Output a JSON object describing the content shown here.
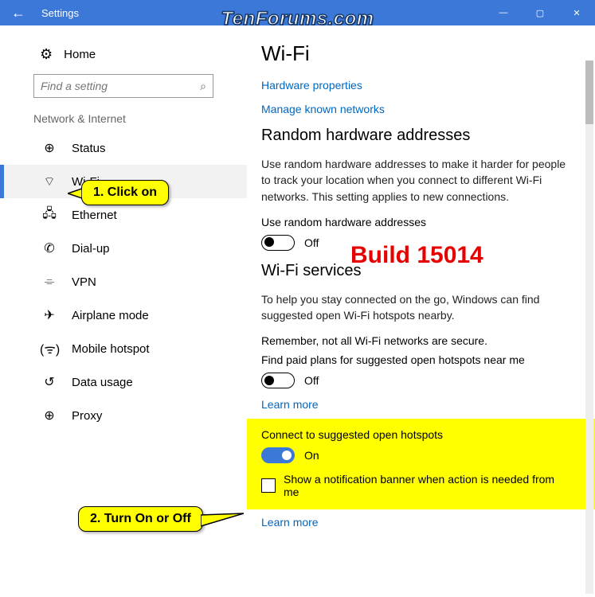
{
  "titlebar": {
    "title": "Settings",
    "back_icon": "←",
    "min_icon": "—",
    "max_icon": "▢",
    "close_icon": "✕"
  },
  "watermark": "TenForums.com",
  "sidebar": {
    "home_label": "Home",
    "gear_icon": "⚙",
    "search_placeholder": "Find a setting",
    "search_icon": "⌕",
    "section_label": "Network & Internet",
    "items": [
      {
        "icon": "⊕",
        "label": "Status"
      },
      {
        "icon": "⌔",
        "label": "Wi-Fi"
      },
      {
        "icon": "🖧",
        "label": "Ethernet"
      },
      {
        "icon": "✆",
        "label": "Dial-up"
      },
      {
        "icon": "⌯",
        "label": "VPN"
      },
      {
        "icon": "✈",
        "label": "Airplane mode"
      },
      {
        "icon": "(ᯤ)",
        "label": "Mobile hotspot"
      },
      {
        "icon": "↺",
        "label": "Data usage"
      },
      {
        "icon": "⊕",
        "label": "Proxy"
      }
    ],
    "selected_index": 1
  },
  "main": {
    "h1": "Wi-Fi",
    "link_hw": "Hardware properties",
    "link_known": "Manage known networks",
    "h2_rand": "Random hardware addresses",
    "rand_desc": "Use random hardware addresses to make it harder for people to track your location when you connect to different Wi-Fi networks. This setting applies to new connections.",
    "rand_toggle_label": "Use random hardware addresses",
    "rand_toggle_state": "Off",
    "h2_services": "Wi-Fi services",
    "services_desc": "To help you stay connected on the go, Windows can find suggested open Wi-Fi hotspots nearby.",
    "services_note": "Remember, not all Wi-Fi networks are secure.",
    "paid_label": "Find paid plans for suggested open hotspots near me",
    "paid_state": "Off",
    "learn_more": "Learn more",
    "connect_label": "Connect to suggested open hotspots",
    "connect_state": "On",
    "banner_label": "Show a notification banner when action is needed from me"
  },
  "overlay": {
    "callout1": "1. Click on",
    "callout2": "2. Turn On or Off",
    "build": "Build 15014"
  }
}
